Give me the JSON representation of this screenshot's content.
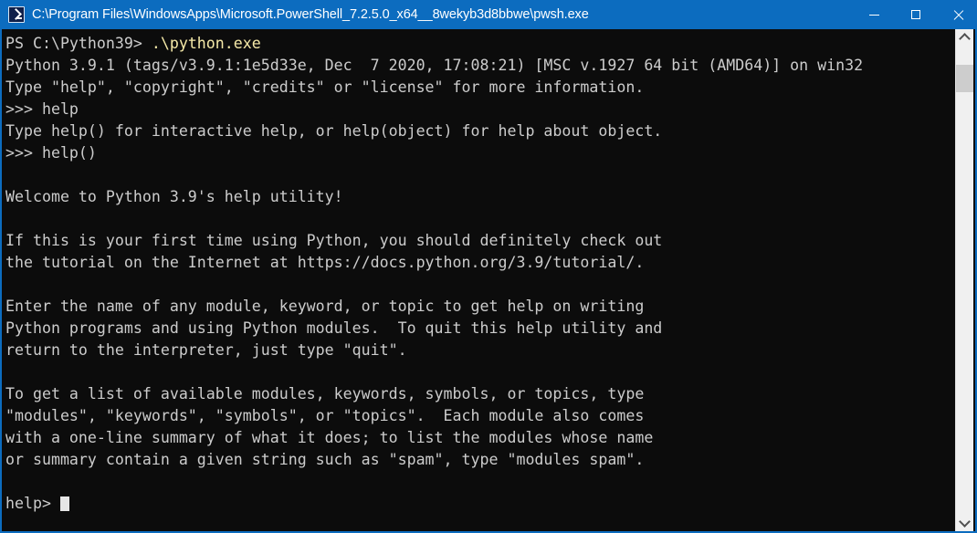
{
  "window": {
    "title": "C:\\Program Files\\WindowsApps\\Microsoft.PowerShell_7.2.5.0_x64__8wekyb3d8bbwe\\pwsh.exe",
    "icon": "powershell-icon",
    "border_color": "#0c6cbf",
    "titlebar_color": "#0c6cbf",
    "background_color": "#0c0c0c",
    "controls": {
      "minimize_label": "–",
      "maximize_label": "□",
      "close_label": "✕"
    }
  },
  "terminal": {
    "foreground_color": "#cccccc",
    "command_color": "#f5e9a8",
    "lines": [
      {
        "segments": [
          {
            "text": "PS C:\\Python39> ",
            "color": "white"
          },
          {
            "text": ".\\python.exe",
            "color": "yellow"
          }
        ]
      },
      {
        "segments": [
          {
            "text": "Python 3.9.1 (tags/v3.9.1:1e5d33e, Dec  7 2020, 17:08:21) [MSC v.1927 64 bit (AMD64)] on win32",
            "color": "white"
          }
        ]
      },
      {
        "segments": [
          {
            "text": "Type \"help\", \"copyright\", \"credits\" or \"license\" for more information.",
            "color": "white"
          }
        ]
      },
      {
        "segments": [
          {
            "text": ">>> help",
            "color": "white"
          }
        ]
      },
      {
        "segments": [
          {
            "text": "Type help() for interactive help, or help(object) for help about object.",
            "color": "white"
          }
        ]
      },
      {
        "segments": [
          {
            "text": ">>> help()",
            "color": "white"
          }
        ]
      },
      {
        "segments": [
          {
            "text": "",
            "color": "white"
          }
        ]
      },
      {
        "segments": [
          {
            "text": "Welcome to Python 3.9's help utility!",
            "color": "white"
          }
        ]
      },
      {
        "segments": [
          {
            "text": "",
            "color": "white"
          }
        ]
      },
      {
        "segments": [
          {
            "text": "If this is your first time using Python, you should definitely check out",
            "color": "white"
          }
        ]
      },
      {
        "segments": [
          {
            "text": "the tutorial on the Internet at https://docs.python.org/3.9/tutorial/.",
            "color": "white"
          }
        ]
      },
      {
        "segments": [
          {
            "text": "",
            "color": "white"
          }
        ]
      },
      {
        "segments": [
          {
            "text": "Enter the name of any module, keyword, or topic to get help on writing",
            "color": "white"
          }
        ]
      },
      {
        "segments": [
          {
            "text": "Python programs and using Python modules.  To quit this help utility and",
            "color": "white"
          }
        ]
      },
      {
        "segments": [
          {
            "text": "return to the interpreter, just type \"quit\".",
            "color": "white"
          }
        ]
      },
      {
        "segments": [
          {
            "text": "",
            "color": "white"
          }
        ]
      },
      {
        "segments": [
          {
            "text": "To get a list of available modules, keywords, symbols, or topics, type",
            "color": "white"
          }
        ]
      },
      {
        "segments": [
          {
            "text": "\"modules\", \"keywords\", \"symbols\", or \"topics\".  Each module also comes",
            "color": "white"
          }
        ]
      },
      {
        "segments": [
          {
            "text": "with a one-line summary of what it does; to list the modules whose name",
            "color": "white"
          }
        ]
      },
      {
        "segments": [
          {
            "text": "or summary contain a given string such as \"spam\", type \"modules spam\".",
            "color": "white"
          }
        ]
      },
      {
        "segments": [
          {
            "text": "",
            "color": "white"
          }
        ]
      },
      {
        "segments": [
          {
            "text": "help> ",
            "color": "white"
          }
        ],
        "cursor": true
      }
    ]
  },
  "scrollbar": {
    "up_arrow": "scroll-up-arrow",
    "down_arrow": "scroll-down-arrow",
    "thumb_top_percent": 4,
    "thumb_height_percent": 6
  }
}
